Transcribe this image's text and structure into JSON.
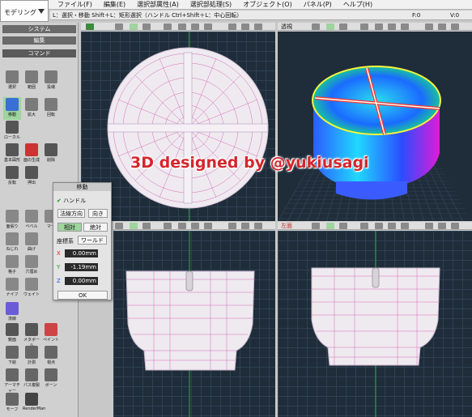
{
  "menubar": {
    "mode": "モデリング",
    "items": [
      "ファイル(F)",
      "編集(E)",
      "選択部属性(A)",
      "選択部処理(S)",
      "オブジェクト(O)",
      "パネル(P)",
      "ヘルプ(H)"
    ]
  },
  "infobar": {
    "hint": "L：選択・移動  Shift＋L：矩形選択（ハンドル  Ctrl+Shift＋L：中心回転）",
    "f_value": "F:0",
    "v_value": "V:0"
  },
  "left_panel": {
    "tab_system": "システム",
    "tab_edit": "編集",
    "tab_command": "コマンド",
    "tools": [
      "選択",
      "範囲",
      "投縄",
      "移動",
      "拡大",
      "回転",
      "ローカル",
      "基本図形",
      "面の生成",
      "削除",
      "反転",
      "押出",
      "面張り",
      "ベベル",
      "マー",
      "ねじれ",
      "曲げ",
      "格子",
      "穴埋め",
      "ナイフ",
      "ウェイト",
      "流線",
      "鏡面",
      "メタボール",
      "ペイント",
      "下絵",
      "計測",
      "視点",
      "アーマチャー",
      "パス複製",
      "ボーン",
      "モーフ",
      "RenderMan"
    ]
  },
  "move_dialog": {
    "title": "移動",
    "handle_label": "ハンドル",
    "normal_button": "法線方向",
    "direction_button": "向き",
    "relative_button": "相対",
    "absolute_button": "絶対",
    "coord_label": "座標系",
    "world_button": "ワールド",
    "x_label": "X",
    "x_value": "0.00mm",
    "y_label": "Y",
    "y_value": "-1.19mm",
    "z_label": "Z",
    "z_value": "0.00mm",
    "ok_button": "OK"
  },
  "viewports": {
    "perspective_label": "透視",
    "left_label": "左面"
  },
  "watermark": "3D designed by @yukiusagi",
  "colors": {
    "viewport_bg": "#1f2d3a",
    "watermark": "#d4262d",
    "tool_selected": "#9ed49e"
  }
}
